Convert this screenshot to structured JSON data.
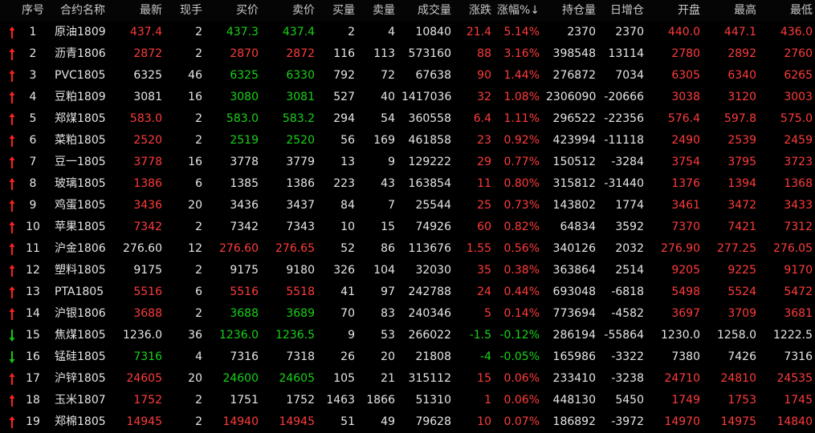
{
  "colors": {
    "up": "#ff3b3b",
    "down": "#19d219",
    "neutral": "#e6e6e6",
    "arrow_up": "#ff2020",
    "arrow_down": "#16c516",
    "header": "#c8c8c8",
    "yellow": "#ffff66"
  },
  "header": {
    "seq": "序号",
    "name": "合约名称",
    "last": "最新",
    "vol_hand": "现手",
    "bid": "买价",
    "ask": "卖价",
    "bid_vol": "买量",
    "ask_vol": "卖量",
    "volume": "成交量",
    "change": "涨跌",
    "pct": "涨幅%↓",
    "oi": "持仓量",
    "oi_chg": "日增仓",
    "open": "开盘",
    "high": "最高",
    "low": "最低"
  },
  "rows": [
    {
      "dir": "up",
      "seq": "1",
      "name": "原油1809",
      "last": "437.4",
      "hand": "2",
      "bid": "437.3",
      "ask": "437.4",
      "bidv": "2",
      "askv": "4",
      "vol": "10840",
      "chg": "21.4",
      "pct": "5.14%",
      "oi": "2370",
      "oic": "2370",
      "open": "440.0",
      "high": "447.1",
      "low": "436.0",
      "c": {
        "last": "up",
        "bid": "down",
        "ask": "down",
        "open": "up",
        "high": "up",
        "low": "up"
      }
    },
    {
      "dir": "up",
      "seq": "2",
      "name": "沥青1806",
      "last": "2872",
      "hand": "2",
      "bid": "2870",
      "ask": "2872",
      "bidv": "116",
      "askv": "113",
      "vol": "573160",
      "chg": "88",
      "pct": "3.16%",
      "oi": "398548",
      "oic": "13114",
      "open": "2780",
      "high": "2892",
      "low": "2760",
      "c": {
        "last": "up",
        "bid": "up",
        "ask": "up",
        "open": "up",
        "high": "up",
        "low": "up"
      }
    },
    {
      "dir": "up",
      "seq": "3",
      "name": "PVC1805",
      "last": "6325",
      "hand": "46",
      "bid": "6325",
      "ask": "6330",
      "bidv": "792",
      "askv": "72",
      "vol": "67638",
      "chg": "90",
      "pct": "1.44%",
      "oi": "276872",
      "oic": "7034",
      "open": "6305",
      "high": "6340",
      "low": "6265",
      "c": {
        "last": "neutral",
        "bid": "down",
        "ask": "down",
        "open": "up",
        "high": "up",
        "low": "up"
      }
    },
    {
      "dir": "up",
      "seq": "4",
      "name": "豆粕1809",
      "last": "3081",
      "hand": "16",
      "bid": "3080",
      "ask": "3081",
      "bidv": "527",
      "askv": "40",
      "vol": "1417036",
      "chg": "32",
      "pct": "1.08%",
      "oi": "2306090",
      "oic": "-20666",
      "open": "3038",
      "high": "3120",
      "low": "3003",
      "c": {
        "last": "neutral",
        "bid": "down",
        "ask": "down",
        "open": "up",
        "high": "up",
        "low": "up"
      }
    },
    {
      "dir": "up",
      "seq": "5",
      "name": "郑煤1805",
      "last": "583.0",
      "hand": "2",
      "bid": "583.0",
      "ask": "583.2",
      "bidv": "294",
      "askv": "54",
      "vol": "360558",
      "chg": "6.4",
      "pct": "1.11%",
      "oi": "296522",
      "oic": "-22356",
      "open": "576.4",
      "high": "597.8",
      "low": "575.0",
      "c": {
        "last": "up",
        "bid": "down",
        "ask": "down",
        "open": "up",
        "high": "up",
        "low": "up"
      }
    },
    {
      "dir": "up",
      "seq": "6",
      "name": "菜粕1805",
      "last": "2520",
      "hand": "2",
      "bid": "2519",
      "ask": "2520",
      "bidv": "56",
      "askv": "169",
      "vol": "461858",
      "chg": "23",
      "pct": "0.92%",
      "oi": "423994",
      "oic": "-11118",
      "open": "2490",
      "high": "2539",
      "low": "2459",
      "c": {
        "last": "up",
        "bid": "down",
        "ask": "down",
        "open": "up",
        "high": "up",
        "low": "up"
      }
    },
    {
      "dir": "up",
      "seq": "7",
      "name": "豆一1805",
      "last": "3778",
      "hand": "16",
      "bid": "3778",
      "ask": "3779",
      "bidv": "13",
      "askv": "9",
      "vol": "129222",
      "chg": "29",
      "pct": "0.77%",
      "oi": "150512",
      "oic": "-3284",
      "open": "3754",
      "high": "3795",
      "low": "3723",
      "c": {
        "last": "up",
        "bid": "neutral",
        "ask": "neutral",
        "open": "up",
        "high": "up",
        "low": "up"
      }
    },
    {
      "dir": "up",
      "seq": "8",
      "name": "玻璃1805",
      "last": "1386",
      "hand": "6",
      "bid": "1385",
      "ask": "1386",
      "bidv": "223",
      "askv": "43",
      "vol": "163854",
      "chg": "11",
      "pct": "0.80%",
      "oi": "315812",
      "oic": "-31440",
      "open": "1376",
      "high": "1394",
      "low": "1368",
      "c": {
        "last": "up",
        "bid": "neutral",
        "ask": "neutral",
        "open": "up",
        "high": "up",
        "low": "up"
      }
    },
    {
      "dir": "up",
      "seq": "9",
      "name": "鸡蛋1805",
      "last": "3436",
      "hand": "20",
      "bid": "3436",
      "ask": "3437",
      "bidv": "84",
      "askv": "7",
      "vol": "25544",
      "chg": "25",
      "pct": "0.73%",
      "oi": "143802",
      "oic": "1774",
      "open": "3461",
      "high": "3472",
      "low": "3433",
      "c": {
        "last": "up",
        "bid": "neutral",
        "ask": "neutral",
        "open": "up",
        "high": "up",
        "low": "up"
      }
    },
    {
      "dir": "up",
      "seq": "10",
      "name": "苹果1805",
      "last": "7342",
      "hand": "2",
      "bid": "7342",
      "ask": "7343",
      "bidv": "10",
      "askv": "15",
      "vol": "74926",
      "chg": "60",
      "pct": "0.82%",
      "oi": "64834",
      "oic": "3592",
      "open": "7370",
      "high": "7421",
      "low": "7312",
      "c": {
        "last": "up",
        "bid": "neutral",
        "ask": "neutral",
        "open": "up",
        "high": "up",
        "low": "up"
      }
    },
    {
      "dir": "up",
      "seq": "11",
      "name": "沪金1806",
      "last": "276.60",
      "hand": "12",
      "bid": "276.60",
      "ask": "276.65",
      "bidv": "52",
      "askv": "86",
      "vol": "113676",
      "chg": "1.55",
      "pct": "0.56%",
      "oi": "340126",
      "oic": "2032",
      "open": "276.90",
      "high": "277.25",
      "low": "276.05",
      "c": {
        "last": "neutral",
        "bid": "up",
        "ask": "up",
        "open": "up",
        "high": "up",
        "low": "up"
      }
    },
    {
      "dir": "up",
      "seq": "12",
      "name": "塑料1805",
      "last": "9175",
      "hand": "2",
      "bid": "9175",
      "ask": "9180",
      "bidv": "326",
      "askv": "104",
      "vol": "32030",
      "chg": "35",
      "pct": "0.38%",
      "oi": "363864",
      "oic": "2514",
      "open": "9205",
      "high": "9225",
      "low": "9170",
      "c": {
        "last": "neutral",
        "bid": "neutral",
        "ask": "neutral",
        "open": "up",
        "high": "up",
        "low": "up"
      }
    },
    {
      "dir": "up",
      "seq": "13",
      "name": "PTA1805",
      "last": "5516",
      "hand": "6",
      "bid": "5516",
      "ask": "5518",
      "bidv": "41",
      "askv": "97",
      "vol": "242788",
      "chg": "24",
      "pct": "0.44%",
      "oi": "693048",
      "oic": "-6818",
      "open": "5498",
      "high": "5524",
      "low": "5472",
      "c": {
        "last": "up",
        "bid": "up",
        "ask": "up",
        "open": "up",
        "high": "up",
        "low": "up"
      }
    },
    {
      "dir": "up",
      "seq": "14",
      "name": "沪银1806",
      "last": "3688",
      "hand": "2",
      "bid": "3688",
      "ask": "3689",
      "bidv": "70",
      "askv": "83",
      "vol": "240346",
      "chg": "5",
      "pct": "0.14%",
      "oi": "773694",
      "oic": "-4582",
      "open": "3697",
      "high": "3709",
      "low": "3681",
      "c": {
        "last": "up",
        "bid": "down",
        "ask": "down",
        "open": "up",
        "high": "up",
        "low": "up"
      }
    },
    {
      "dir": "down",
      "seq": "15",
      "name": "焦煤1805",
      "last": "1236.0",
      "hand": "36",
      "bid": "1236.0",
      "ask": "1236.5",
      "bidv": "9",
      "askv": "53",
      "vol": "266022",
      "chg": "-1.5",
      "pct": "-0.12%",
      "oi": "286194",
      "oic": "-55864",
      "open": "1230.0",
      "high": "1258.0",
      "low": "1222.5",
      "c": {
        "last": "neutral",
        "bid": "down",
        "ask": "down",
        "open": "neutral",
        "high": "neutral",
        "low": "neutral"
      }
    },
    {
      "dir": "down",
      "seq": "16",
      "name": "锰硅1805",
      "last": "7316",
      "hand": "4",
      "bid": "7316",
      "ask": "7318",
      "bidv": "26",
      "askv": "20",
      "vol": "21808",
      "chg": "-4",
      "pct": "-0.05%",
      "oi": "165986",
      "oic": "-3322",
      "open": "7380",
      "high": "7426",
      "low": "7316",
      "c": {
        "last": "down",
        "bid": "neutral",
        "ask": "neutral",
        "open": "neutral",
        "high": "neutral",
        "low": "neutral"
      }
    },
    {
      "dir": "up",
      "seq": "17",
      "name": "沪锌1805",
      "last": "24605",
      "hand": "20",
      "bid": "24600",
      "ask": "24605",
      "bidv": "105",
      "askv": "21",
      "vol": "315112",
      "chg": "15",
      "pct": "0.06%",
      "oi": "233410",
      "oic": "-3238",
      "open": "24710",
      "high": "24810",
      "low": "24535",
      "c": {
        "last": "up",
        "bid": "down",
        "ask": "down",
        "open": "up",
        "high": "up",
        "low": "up"
      }
    },
    {
      "dir": "up",
      "seq": "18",
      "name": "玉米1807",
      "last": "1752",
      "hand": "2",
      "bid": "1751",
      "ask": "1752",
      "bidv": "1463",
      "askv": "1866",
      "vol": "51310",
      "chg": "1",
      "pct": "0.06%",
      "oi": "448130",
      "oic": "5450",
      "open": "1749",
      "high": "1753",
      "low": "1745",
      "c": {
        "last": "up",
        "bid": "neutral",
        "ask": "neutral",
        "open": "up",
        "high": "up",
        "low": "up"
      }
    },
    {
      "dir": "up",
      "seq": "19",
      "name": "郑棉1805",
      "last": "14945",
      "hand": "2",
      "bid": "14940",
      "ask": "14945",
      "bidv": "51",
      "askv": "49",
      "vol": "79628",
      "chg": "10",
      "pct": "0.07%",
      "oi": "186892",
      "oic": "-3972",
      "open": "14970",
      "high": "14975",
      "low": "14840",
      "c": {
        "last": "up",
        "bid": "up",
        "ask": "up",
        "open": "up",
        "high": "up",
        "low": "up"
      }
    }
  ]
}
